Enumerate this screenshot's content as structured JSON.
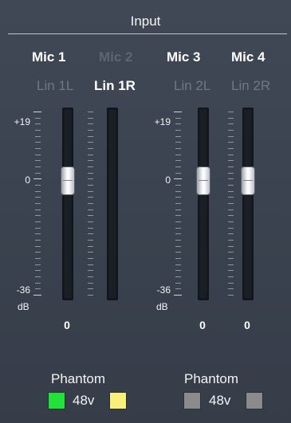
{
  "title": "Input",
  "mic_buttons": [
    {
      "label": "Mic  1",
      "active": true
    },
    {
      "label": "Mic  2",
      "active": false
    },
    {
      "label": "Mic  3",
      "active": true
    },
    {
      "label": "Mic  4",
      "active": true
    }
  ],
  "line_buttons": [
    {
      "label": "Lin 1L",
      "active": false
    },
    {
      "label": "Lin 1R",
      "active": true
    },
    {
      "label": "Lin 2L",
      "active": false
    },
    {
      "label": "Lin 2R",
      "active": false
    }
  ],
  "scale": {
    "top": "+19",
    "mid": "0",
    "bottom": "-36",
    "unit": "dB"
  },
  "channels": [
    {
      "value": "0"
    },
    {
      "value": "0"
    },
    {
      "value": "0"
    }
  ],
  "phantom": [
    {
      "label": "Phantom",
      "voltage": "48v",
      "left_color": "#22e13a",
      "right_color": "#f7f07a"
    },
    {
      "label": "Phantom",
      "voltage": "48v",
      "left_color": "#8b8b8b",
      "right_color": "#8b8b8b"
    }
  ]
}
